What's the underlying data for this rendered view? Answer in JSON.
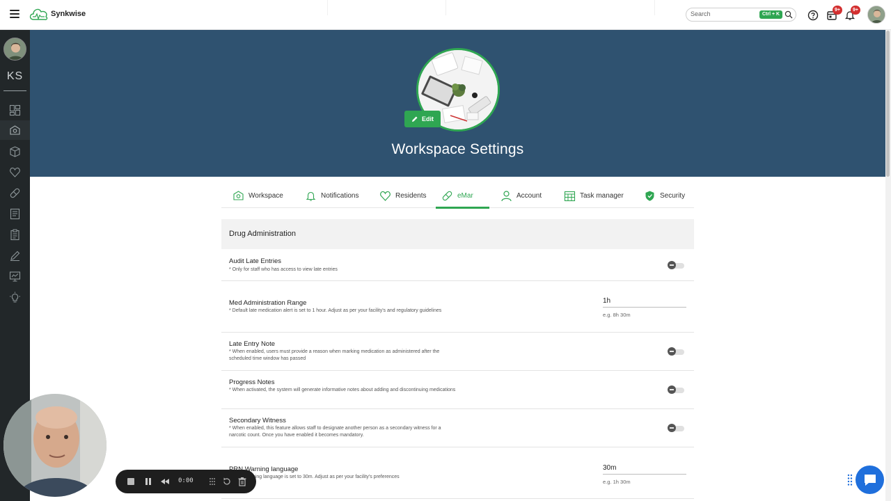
{
  "app": {
    "brand": "Synkwise"
  },
  "header": {
    "search_placeholder": "Search",
    "shortcut": "Ctrl + K",
    "calendar_badge": "9+",
    "notifications_badge": "9+"
  },
  "sidebar": {
    "initials": "KS",
    "items": [
      {
        "icon": "dashboard-icon"
      },
      {
        "icon": "workspace-icon"
      },
      {
        "icon": "box-icon"
      },
      {
        "icon": "heart-icon"
      },
      {
        "icon": "pill-icon"
      },
      {
        "icon": "report-icon"
      },
      {
        "icon": "clipboard-icon"
      },
      {
        "icon": "pen-icon"
      },
      {
        "icon": "monitor-icon"
      },
      {
        "icon": "lightbulb-icon"
      }
    ]
  },
  "hero": {
    "edit_label": "Edit",
    "title": "Workspace Settings"
  },
  "tabs": [
    {
      "label": "Workspace",
      "icon": "workspace-icon"
    },
    {
      "label": "Notifications",
      "icon": "bell-icon"
    },
    {
      "label": "Residents",
      "icon": "heart-icon"
    },
    {
      "label": "eMar",
      "icon": "pill-icon",
      "active": true
    },
    {
      "label": "Account",
      "icon": "person-icon"
    },
    {
      "label": "Task manager",
      "icon": "calendar-grid-icon"
    },
    {
      "label": "Security",
      "icon": "shield-icon"
    }
  ],
  "section": {
    "title": "Drug Administration"
  },
  "settings": [
    {
      "title": "Audit Late Entries",
      "desc": "* Only for staff who has access to view late entries",
      "type": "toggle",
      "enabled": false
    },
    {
      "title": "Med Administration Range",
      "desc": "* Default late medication alert is set to 1 hour. Adjust as per your facility's and regulatory guidelines",
      "type": "duration",
      "value": "1h",
      "hint": "e.g. 8h 30m"
    },
    {
      "title": "Late Entry Note",
      "desc": "* When enabled, users must provide a reason when marking medication as administered after the scheduled time window has passed",
      "type": "toggle",
      "enabled": false
    },
    {
      "title": "Progress Notes",
      "desc": "* When activated, the system will generate informative notes about adding and discontinuing medications",
      "type": "toggle",
      "enabled": false
    },
    {
      "title": "Secondary Witness",
      "desc": "* When enabled, this feature allows staff to designate another person as a secondary witness for a narcotic count. Once you have enabled it becomes mandatory.",
      "type": "toggle",
      "enabled": false
    },
    {
      "title": "PRN Warning language",
      "desc": "* PRN Warning language is set to 30m. Adjust as per your facility's preferences",
      "type": "duration",
      "value": "30m",
      "hint": "e.g. 1h 30m"
    }
  ],
  "recorder": {
    "time": "0:00"
  },
  "colors": {
    "accent": "#2fa652",
    "hero": "#2f5270",
    "sidebar": "#222729",
    "badge": "#d32f2f",
    "chat": "#1f6fdc"
  }
}
